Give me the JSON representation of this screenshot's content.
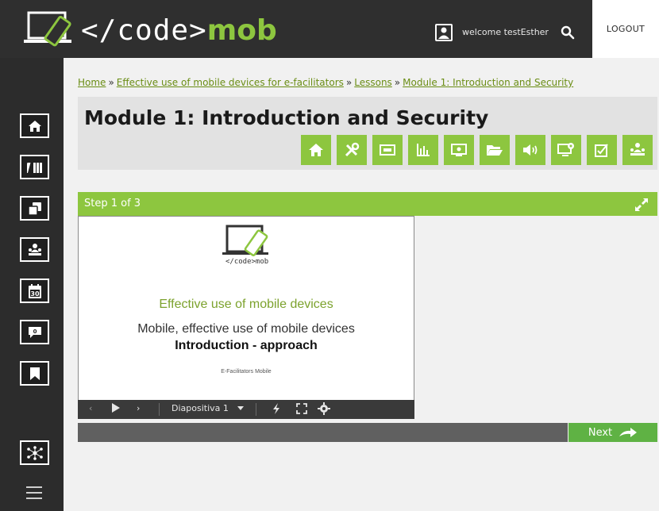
{
  "header": {
    "logo_prefix": "</code>",
    "logo_brand": "mob",
    "welcome": "welcome testEsther",
    "logout": "LOGOUT"
  },
  "sidebar": {
    "items": [
      {
        "name": "home"
      },
      {
        "name": "library"
      },
      {
        "name": "copies"
      },
      {
        "name": "community"
      },
      {
        "name": "calendar",
        "badge": "30"
      },
      {
        "name": "messages",
        "badge": "0"
      },
      {
        "name": "bookmark"
      },
      {
        "name": "network"
      },
      {
        "name": "menu"
      }
    ]
  },
  "breadcrumb": {
    "home": "Home",
    "course": "Effective use of mobile devices for e-facilitators",
    "lessons": "Lessons",
    "module": "Module 1: Introduction and Security",
    "separator": "»"
  },
  "page_title": "Module 1: Introduction and Security",
  "toolbar": [
    "home",
    "tools",
    "code",
    "chart",
    "video",
    "folder",
    "audio",
    "screen",
    "assignment",
    "community"
  ],
  "step": {
    "label": "Step 1 of 3"
  },
  "slide": {
    "logo_text": "</code>mob",
    "title": "Effective use of mobile devices",
    "subtitle": "Mobile, effective use of mobile devices",
    "heading": "Introduction - approach",
    "footer": "E-Facilitators Mobile"
  },
  "player": {
    "slide_select": "Diapositiva 1"
  },
  "next": "Next",
  "colors": {
    "accent": "#8dc63f",
    "next": "#5fb244",
    "dark": "#2f2f2f"
  }
}
